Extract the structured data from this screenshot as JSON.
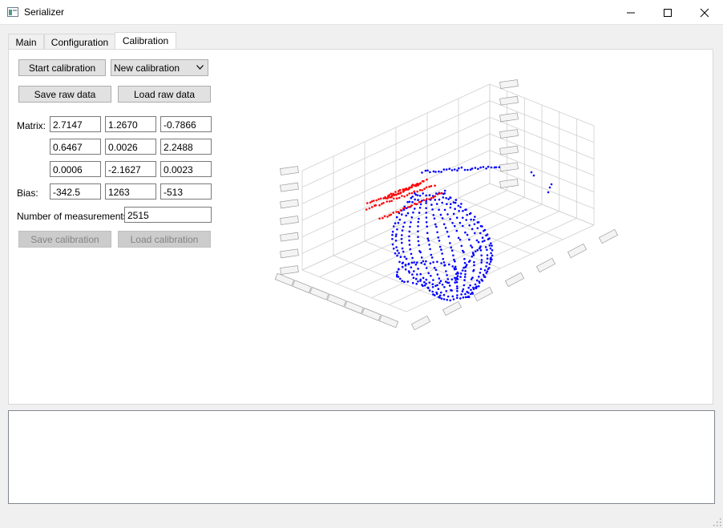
{
  "window": {
    "title": "Serializer",
    "icon": "app-window-icon",
    "controls": [
      "minimize-icon",
      "maximize-icon",
      "close-icon"
    ]
  },
  "tabs": [
    {
      "label": "Main",
      "active": false
    },
    {
      "label": "Configuration",
      "active": false
    },
    {
      "label": "Calibration",
      "active": true
    }
  ],
  "calibration": {
    "start_button": "Start calibration",
    "mode_select": {
      "value": "New calibration"
    },
    "save_raw_button": "Save raw data",
    "load_raw_button": "Load raw data",
    "matrix_label": "Matrix:",
    "matrix": [
      [
        "2.7147",
        "1.2670",
        "-0.7866"
      ],
      [
        "0.6467",
        "0.0026",
        "2.2488"
      ],
      [
        "0.0006",
        "-2.1627",
        "0.0023"
      ]
    ],
    "bias_label": "Bias:",
    "bias": [
      "-342.5",
      "1263",
      "-513"
    ],
    "measurements_label": "Number of measurements:",
    "measurements_value": "2515",
    "save_calibration_button": "Save calibration",
    "load_calibration_button": "Load calibration"
  },
  "plot": {
    "type": "scatter3d",
    "series": [
      {
        "color": "#0000ff"
      },
      {
        "color": "#ff0000"
      }
    ]
  },
  "colors": {
    "accent_blue": "#0000ff",
    "accent_red": "#ff0000"
  }
}
